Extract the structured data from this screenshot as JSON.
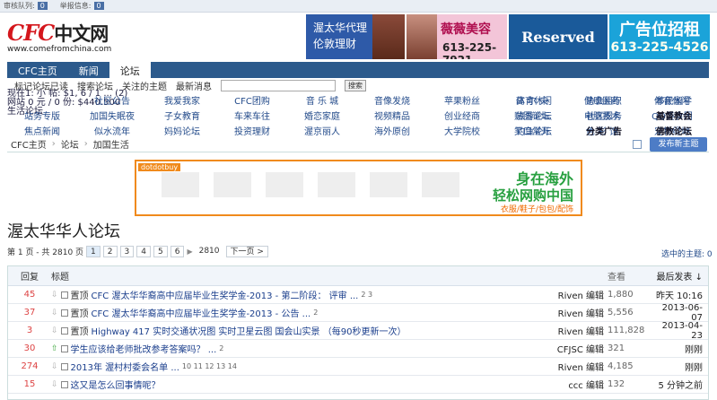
{
  "topbar": {
    "audit_label": "审核队列:",
    "audit_count": "0",
    "report_label": "举报信息:",
    "report_count": "0"
  },
  "logo": {
    "title": "CFC",
    "title_cn": "中文网",
    "url": "www.comefromchina.com"
  },
  "ads": {
    "ad1": {
      "line1": "渥太华代理",
      "line2": "伦敦理财"
    },
    "ad2": {
      "line1": "薇薇美容",
      "line2": "613-225-7921"
    },
    "ad3": {
      "label": "Reserved"
    },
    "ad4": {
      "line1": "广告位招租",
      "line2": "613-225-4526"
    }
  },
  "nav": {
    "tabs": [
      "CFC主页",
      "新闻",
      "论坛"
    ]
  },
  "subnav": {
    "items": [
      "标记论坛已读",
      "搜索论坛",
      "关注的主题",
      "最新消息"
    ],
    "search_btn": "搜索"
  },
  "overlay": {
    "line1": "现在1: 小 帖: $1, 6 / 1 ... (2)",
    "line2": "网站 0 元 / 0 份: $440.500",
    "line3": "生活论坛"
  },
  "categories": [
    [
      "CFC新闻",
      "渥太华论坛",
      "社区公告",
      "我爱我家",
      "CFC团购",
      "音 乐 城",
      "音像发烧",
      "苹果粉丝",
      "高 尔 夫",
      "健康医药",
      "体育休闲",
      "协会组织",
      "移民留学"
    ],
    [
      "站务专版",
      "加国失眠夜",
      "子女教育",
      "车来车往",
      "婚恋家庭",
      "视频精品",
      "创业经商",
      "贴图论坛",
      "电脑技术",
      "QQ美食团",
      "旅游论坛",
      "社区服务",
      "基督教会"
    ],
    [
      "焦点新闻",
      "似水流年",
      "妈妈论坛",
      "投资理财",
      "渥京丽人",
      "海外原创",
      "大学院校",
      "笑口常开",
      "色 彩 馆",
      "宠物绿地",
      "钓鱼论坛",
      "分类广告",
      "佛教论坛"
    ]
  ],
  "breadcrumb": [
    "CFC主页",
    "论坛",
    "加国生活"
  ],
  "new_topic_btn": "发布新主题",
  "banner": {
    "brand": "dotdotbuy",
    "line1": "身在海外",
    "line2": "轻松网购中国",
    "line3": "衣服/鞋子/包包/配饰"
  },
  "forum_title": "渥太华华人论坛",
  "pager": {
    "label": "第 1 页 - 共 2810 页",
    "pages": [
      "1",
      "2",
      "3",
      "4",
      "5",
      "6"
    ],
    "arrow": "▶",
    "last": "2810",
    "next": "下一页 >"
  },
  "selected_label": "选中的主题: 0",
  "table": {
    "headers": {
      "replies": "回复",
      "title": "标题",
      "views": "查看",
      "last": "最后发表 ↓"
    },
    "rows": [
      {
        "replies": "45",
        "prefix": "置顶",
        "title": "CFC 渥太华华裔高中应届毕业生奖学金-2013 - 第二阶段： 评审 ...",
        "pages": "2  3",
        "author": "Riven 编辑",
        "views": "1,880",
        "last": "昨天 10:16",
        "arrow": "⇩"
      },
      {
        "replies": "37",
        "prefix": "置顶",
        "title": "CFC 渥太华华裔高中应届毕业生奖学金-2013 - 公告 ...",
        "pages": "2",
        "author": "Riven 编辑",
        "views": "5,556",
        "last": "2013-06-07",
        "arrow": "⇩"
      },
      {
        "replies": "3",
        "prefix": "置顶",
        "title": "Highway 417 实时交通状况图 实时卫星云图 国会山实景 （每90秒更新一次）",
        "pages": "",
        "author": "Riven 编辑",
        "views": "111,828",
        "last": "2013-04-23",
        "arrow": "⇩"
      },
      {
        "replies": "30",
        "prefix": "",
        "title": "学生应该给老师批改参考答案吗？ ...",
        "pages": "2",
        "author": "CFJSC 编辑",
        "views": "321",
        "last": "刚刚",
        "arrow": "⇧"
      },
      {
        "replies": "274",
        "prefix": "",
        "title": "2013年 渥村村委会名单 ...",
        "pages": "10  11  12  13  14",
        "author": "Riven 编辑",
        "views": "4,185",
        "last": "刚刚",
        "arrow": "⇩"
      },
      {
        "replies": "15",
        "prefix": "",
        "title": "这又是怎么回事情呢？",
        "pages": "",
        "author": "ccc 编辑",
        "views": "132",
        "last": "5 分钟之前",
        "arrow": "⇩"
      }
    ]
  }
}
